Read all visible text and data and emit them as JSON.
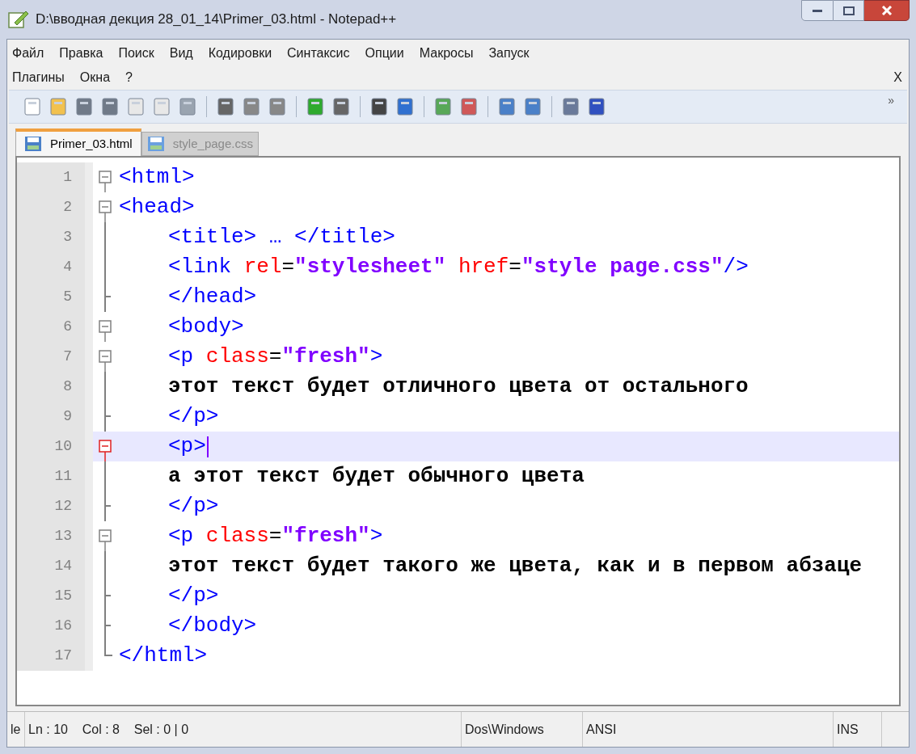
{
  "window": {
    "title": "D:\\вводная декция 28_01_14\\Primer_03.html - Notepad++"
  },
  "menu": {
    "rows": [
      [
        "Файл",
        "Правка",
        "Поиск",
        "Вид",
        "Кодировки",
        "Синтаксис",
        "Опции",
        "Макросы",
        "Запуск"
      ],
      [
        "Плагины",
        "Окна",
        "?"
      ]
    ],
    "close": "X"
  },
  "toolbar": {
    "overflow": "»"
  },
  "tabs": [
    {
      "label": "Primer_03.html",
      "selected": true
    },
    {
      "label": "style_page.css",
      "selected": false
    }
  ],
  "editor": {
    "lines": [
      {
        "number": "1",
        "kind": "start",
        "indented": false,
        "selected": false,
        "tokens": [
          {
            "kind": "tag",
            "text": "<html>"
          }
        ]
      },
      {
        "number": "2",
        "kind": "start",
        "indented": false,
        "selected": false,
        "tokens": [
          {
            "kind": "tag",
            "text": "<head>"
          }
        ]
      },
      {
        "number": "3",
        "kind": "line",
        "indented": true,
        "selected": false,
        "tokens": [
          {
            "kind": "tag",
            "text": "<title> … </title>"
          }
        ]
      },
      {
        "number": "4",
        "kind": "line",
        "indented": true,
        "selected": false,
        "tokens": [
          {
            "kind": "tag",
            "text": "<link "
          },
          {
            "kind": "attr",
            "text": "rel"
          },
          {
            "kind": "op",
            "text": "="
          },
          {
            "kind": "str",
            "text": "\"stylesheet\" "
          },
          {
            "kind": "attr",
            "text": "href"
          },
          {
            "kind": "op",
            "text": "="
          },
          {
            "kind": "str",
            "text": "\"style page.css\""
          },
          {
            "kind": "tag",
            "text": "/>"
          }
        ]
      },
      {
        "number": "5",
        "kind": "branch",
        "indented": true,
        "selected": false,
        "tokens": [
          {
            "kind": "tag",
            "text": "</head>"
          }
        ]
      },
      {
        "number": "6",
        "kind": "start",
        "indented": true,
        "selected": false,
        "tokens": [
          {
            "kind": "tag",
            "text": "<body>"
          }
        ]
      },
      {
        "number": "7",
        "kind": "start",
        "indented": true,
        "selected": false,
        "tokens": [
          {
            "kind": "tag",
            "text": "<p "
          },
          {
            "kind": "attr",
            "text": "class"
          },
          {
            "kind": "op",
            "text": "="
          },
          {
            "kind": "str",
            "text": "\"fresh\""
          },
          {
            "kind": "tag",
            "text": ">"
          }
        ]
      },
      {
        "number": "8",
        "kind": "line",
        "indented": true,
        "selected": false,
        "tokens": [
          {
            "kind": "text",
            "text": "этот текст будет отличного цвета от остального"
          }
        ]
      },
      {
        "number": "9",
        "kind": "branch",
        "indented": true,
        "selected": false,
        "tokens": [
          {
            "kind": "tag",
            "text": "</p>"
          }
        ]
      },
      {
        "number": "10",
        "kind": "start",
        "indented": true,
        "selected": true,
        "tokens": [
          {
            "kind": "tag",
            "text": "<p>"
          }
        ]
      },
      {
        "number": "11",
        "kind": "line",
        "indented": true,
        "selected": false,
        "tokens": [
          {
            "kind": "text",
            "text": "а этот текст будет обычного цвета"
          }
        ]
      },
      {
        "number": "12",
        "kind": "branch",
        "indented": true,
        "selected": false,
        "tokens": [
          {
            "kind": "tag",
            "text": "</p>"
          }
        ]
      },
      {
        "number": "13",
        "kind": "start",
        "indented": true,
        "selected": false,
        "tokens": [
          {
            "kind": "tag",
            "text": "<p "
          },
          {
            "kind": "attr",
            "text": "class"
          },
          {
            "kind": "op",
            "text": "="
          },
          {
            "kind": "str",
            "text": "\"fresh\""
          },
          {
            "kind": "tag",
            "text": ">"
          }
        ]
      },
      {
        "number": "14",
        "kind": "line",
        "indented": true,
        "selected": false,
        "tokens": [
          {
            "kind": "text",
            "text": "этот текст будет такого же цвета, как и в первом абзаце"
          }
        ]
      },
      {
        "number": "15",
        "kind": "branch",
        "indented": true,
        "selected": false,
        "tokens": [
          {
            "kind": "tag",
            "text": "</p>"
          }
        ]
      },
      {
        "number": "16",
        "kind": "branch",
        "indented": true,
        "selected": false,
        "tokens": [
          {
            "kind": "tag",
            "text": "</body>"
          }
        ]
      },
      {
        "number": "17",
        "kind": "end",
        "indented": false,
        "selected": false,
        "tokens": [
          {
            "kind": "tag",
            "text": "</html>"
          }
        ]
      }
    ]
  },
  "status_bar": {
    "cells": [
      "le",
      "Ln : 10    Col : 8    Sel : 0 | 0",
      "Dos\\Windows",
      "ANSI",
      "INS"
    ]
  }
}
